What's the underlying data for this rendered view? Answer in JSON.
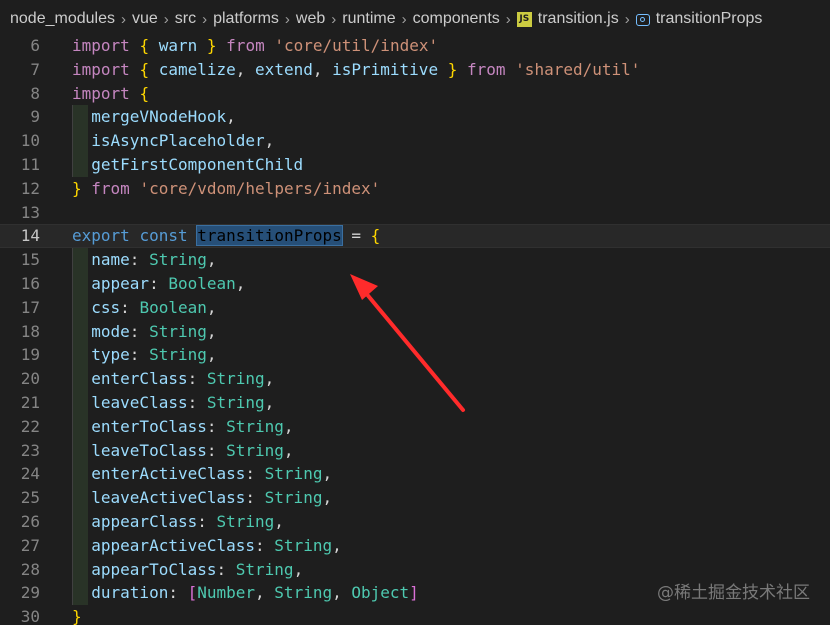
{
  "breadcrumb": {
    "items": [
      "node_modules",
      "vue",
      "src",
      "platforms",
      "web",
      "runtime",
      "components"
    ],
    "file": "transition.js",
    "file_icon": "js-file-icon",
    "symbol": "transitionProps",
    "symbol_icon": "symbol-variable-icon",
    "separator": "›"
  },
  "editor": {
    "current_line": 14,
    "selected_word": "transitionProps"
  },
  "lines": [
    {
      "n": "6",
      "tokens": [
        [
          "kw",
          "import"
        ],
        [
          "pu",
          " "
        ],
        [
          "br",
          "{"
        ],
        [
          "pu",
          " "
        ],
        [
          "id",
          "warn"
        ],
        [
          "pu",
          " "
        ],
        [
          "br",
          "}"
        ],
        [
          "pu",
          " "
        ],
        [
          "kw",
          "from"
        ],
        [
          "pu",
          " "
        ],
        [
          "str",
          "'core/util/index'"
        ]
      ]
    },
    {
      "n": "7",
      "tokens": [
        [
          "kw",
          "import"
        ],
        [
          "pu",
          " "
        ],
        [
          "br",
          "{"
        ],
        [
          "pu",
          " "
        ],
        [
          "id",
          "camelize"
        ],
        [
          "pu",
          ", "
        ],
        [
          "id",
          "extend"
        ],
        [
          "pu",
          ", "
        ],
        [
          "id",
          "isPrimitive"
        ],
        [
          "pu",
          " "
        ],
        [
          "br",
          "}"
        ],
        [
          "pu",
          " "
        ],
        [
          "kw",
          "from"
        ],
        [
          "pu",
          " "
        ],
        [
          "str",
          "'shared/util'"
        ]
      ]
    },
    {
      "n": "8",
      "tokens": [
        [
          "kw",
          "import"
        ],
        [
          "pu",
          " "
        ],
        [
          "br",
          "{"
        ]
      ]
    },
    {
      "n": "9",
      "tokens": [
        [
          "pu",
          "  "
        ],
        [
          "id",
          "mergeVNodeHook"
        ],
        [
          "pu",
          ","
        ]
      ]
    },
    {
      "n": "10",
      "tokens": [
        [
          "pu",
          "  "
        ],
        [
          "id",
          "isAsyncPlaceholder"
        ],
        [
          "pu",
          ","
        ]
      ]
    },
    {
      "n": "11",
      "tokens": [
        [
          "pu",
          "  "
        ],
        [
          "id",
          "getFirstComponentChild"
        ]
      ]
    },
    {
      "n": "12",
      "tokens": [
        [
          "br",
          "}"
        ],
        [
          "pu",
          " "
        ],
        [
          "kw",
          "from"
        ],
        [
          "pu",
          " "
        ],
        [
          "str",
          "'core/vdom/helpers/index'"
        ]
      ]
    },
    {
      "n": "13",
      "tokens": []
    },
    {
      "n": "14",
      "tokens": [
        [
          "kb",
          "export"
        ],
        [
          "pu",
          " "
        ],
        [
          "kb",
          "const"
        ],
        [
          "pu",
          " "
        ],
        [
          "hl",
          "transitionProps"
        ],
        [
          "pu",
          " = "
        ],
        [
          "br",
          "{"
        ]
      ]
    },
    {
      "n": "15",
      "tokens": [
        [
          "pu",
          "  "
        ],
        [
          "id",
          "name"
        ],
        [
          "pu",
          ": "
        ],
        [
          "ty",
          "String"
        ],
        [
          "pu",
          ","
        ]
      ]
    },
    {
      "n": "16",
      "tokens": [
        [
          "pu",
          "  "
        ],
        [
          "id",
          "appear"
        ],
        [
          "pu",
          ": "
        ],
        [
          "ty",
          "Boolean"
        ],
        [
          "pu",
          ","
        ]
      ]
    },
    {
      "n": "17",
      "tokens": [
        [
          "pu",
          "  "
        ],
        [
          "id",
          "css"
        ],
        [
          "pu",
          ": "
        ],
        [
          "ty",
          "Boolean"
        ],
        [
          "pu",
          ","
        ]
      ]
    },
    {
      "n": "18",
      "tokens": [
        [
          "pu",
          "  "
        ],
        [
          "id",
          "mode"
        ],
        [
          "pu",
          ": "
        ],
        [
          "ty",
          "String"
        ],
        [
          "pu",
          ","
        ]
      ]
    },
    {
      "n": "19",
      "tokens": [
        [
          "pu",
          "  "
        ],
        [
          "id",
          "type"
        ],
        [
          "pu",
          ": "
        ],
        [
          "ty",
          "String"
        ],
        [
          "pu",
          ","
        ]
      ]
    },
    {
      "n": "20",
      "tokens": [
        [
          "pu",
          "  "
        ],
        [
          "id",
          "enterClass"
        ],
        [
          "pu",
          ": "
        ],
        [
          "ty",
          "String"
        ],
        [
          "pu",
          ","
        ]
      ]
    },
    {
      "n": "21",
      "tokens": [
        [
          "pu",
          "  "
        ],
        [
          "id",
          "leaveClass"
        ],
        [
          "pu",
          ": "
        ],
        [
          "ty",
          "String"
        ],
        [
          "pu",
          ","
        ]
      ]
    },
    {
      "n": "22",
      "tokens": [
        [
          "pu",
          "  "
        ],
        [
          "id",
          "enterToClass"
        ],
        [
          "pu",
          ": "
        ],
        [
          "ty",
          "String"
        ],
        [
          "pu",
          ","
        ]
      ]
    },
    {
      "n": "23",
      "tokens": [
        [
          "pu",
          "  "
        ],
        [
          "id",
          "leaveToClass"
        ],
        [
          "pu",
          ": "
        ],
        [
          "ty",
          "String"
        ],
        [
          "pu",
          ","
        ]
      ]
    },
    {
      "n": "24",
      "tokens": [
        [
          "pu",
          "  "
        ],
        [
          "id",
          "enterActiveClass"
        ],
        [
          "pu",
          ": "
        ],
        [
          "ty",
          "String"
        ],
        [
          "pu",
          ","
        ]
      ]
    },
    {
      "n": "25",
      "tokens": [
        [
          "pu",
          "  "
        ],
        [
          "id",
          "leaveActiveClass"
        ],
        [
          "pu",
          ": "
        ],
        [
          "ty",
          "String"
        ],
        [
          "pu",
          ","
        ]
      ]
    },
    {
      "n": "26",
      "tokens": [
        [
          "pu",
          "  "
        ],
        [
          "id",
          "appearClass"
        ],
        [
          "pu",
          ": "
        ],
        [
          "ty",
          "String"
        ],
        [
          "pu",
          ","
        ]
      ]
    },
    {
      "n": "27",
      "tokens": [
        [
          "pu",
          "  "
        ],
        [
          "id",
          "appearActiveClass"
        ],
        [
          "pu",
          ": "
        ],
        [
          "ty",
          "String"
        ],
        [
          "pu",
          ","
        ]
      ]
    },
    {
      "n": "28",
      "tokens": [
        [
          "pu",
          "  "
        ],
        [
          "id",
          "appearToClass"
        ],
        [
          "pu",
          ": "
        ],
        [
          "ty",
          "String"
        ],
        [
          "pu",
          ","
        ]
      ]
    },
    {
      "n": "29",
      "tokens": [
        [
          "pu",
          "  "
        ],
        [
          "id",
          "duration"
        ],
        [
          "pu",
          ": "
        ],
        [
          "br2",
          "["
        ],
        [
          "ty",
          "Number"
        ],
        [
          "pu",
          ", "
        ],
        [
          "ty",
          "String"
        ],
        [
          "pu",
          ", "
        ],
        [
          "ty",
          "Object"
        ],
        [
          "br2",
          "]"
        ]
      ]
    },
    {
      "n": "30",
      "tokens": [
        [
          "br",
          "}"
        ]
      ]
    }
  ],
  "lightbulb_icon": "lightbulb-icon",
  "annotation": {
    "arrow_icon": "red-arrow-icon",
    "color": "#ff2b2b"
  },
  "watermark": "@稀土掘金技术社区"
}
